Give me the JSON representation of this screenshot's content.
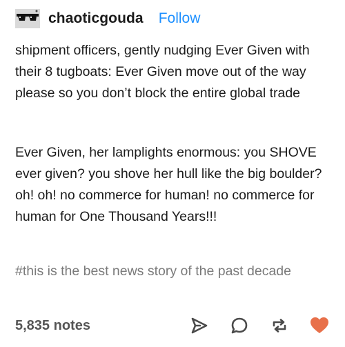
{
  "post": {
    "username": "chaoticgouda",
    "follow_label": "Follow",
    "paragraphs": [
      "shipment officers, gently nudging Ever Given with their 8 tugboats: Ever Given move out of the way please so you don’t block the entire global trade",
      "Ever Given, her lamplights enormous: you SHOVE ever given? you shove her hull like the big boulder? oh! oh! no commerce for human! no commerce for human for One Thousand Years!!!"
    ],
    "tags": "#this is the best news story of the past decade",
    "notes": "5,835 notes"
  },
  "icons": {
    "avatar": "sunglasses-avatar",
    "share": "share-icon",
    "reply": "reply-icon",
    "reblog": "reblog-icon",
    "like": "heart-icon"
  },
  "colors": {
    "follow": "#1e90ff",
    "like": "#e8704a",
    "tags": "#7a7a7a",
    "text": "#1b1b1b",
    "notes": "#555555"
  }
}
